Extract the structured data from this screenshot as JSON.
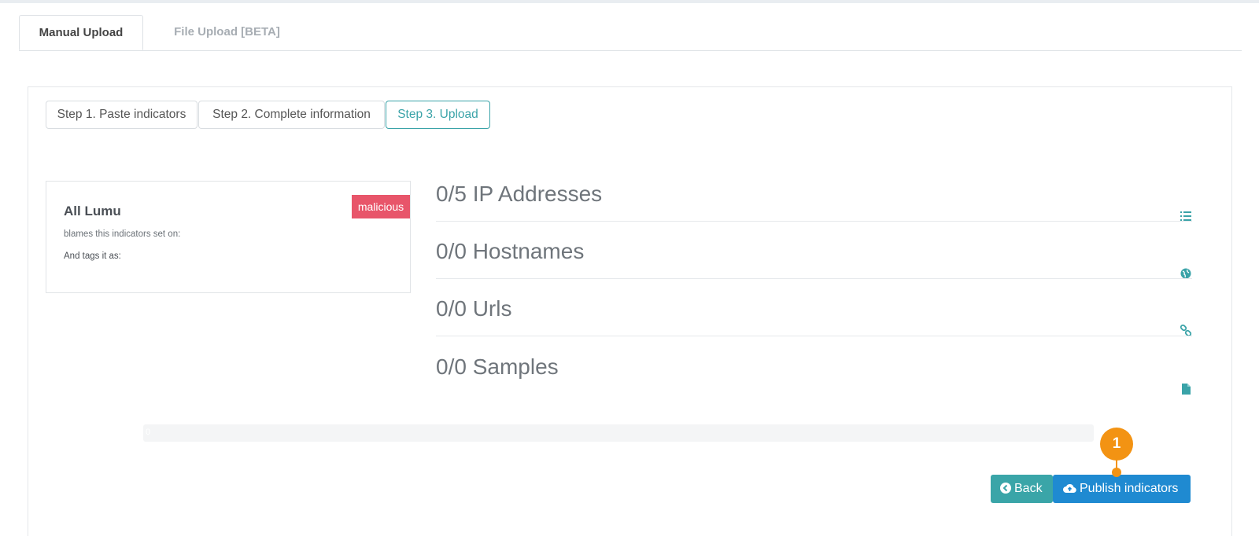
{
  "tabs": [
    {
      "label": "Manual Upload",
      "active": true
    },
    {
      "label": "File Upload [BETA]",
      "active": false
    }
  ],
  "steps": [
    {
      "label": "Step 1. Paste indicators"
    },
    {
      "label": "Step 2. Complete information"
    },
    {
      "label": "Step 3. Upload",
      "active": true
    }
  ],
  "card": {
    "title": "All Lumu",
    "badge": "malicious",
    "blames_text": "blames this indicators set on:",
    "tags_text": "And tags it as:"
  },
  "stats": [
    {
      "label": "0/5 IP Addresses",
      "icon": "list-icon"
    },
    {
      "label": "0/0 Hostnames",
      "icon": "globe-icon"
    },
    {
      "label": "0/0 Urls",
      "icon": "link-icon"
    },
    {
      "label": "0/0 Samples",
      "icon": "file-icon"
    }
  ],
  "progress": {
    "value": "0",
    "percent": 0
  },
  "buttons": {
    "back": "Back",
    "publish": "Publish indicators"
  },
  "annotation": {
    "marker": "1"
  },
  "colors": {
    "accent": "#3aa3a8",
    "primary": "#1f8ad1",
    "danger": "#e8556a",
    "marker": "#f39313"
  }
}
